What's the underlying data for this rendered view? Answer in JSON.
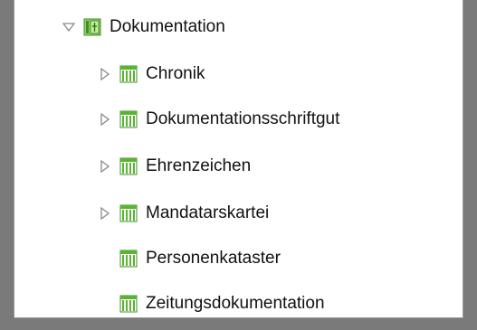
{
  "tree": {
    "root": {
      "label": "Dokumentation",
      "expanded": true,
      "icon": "folder-book-icon"
    },
    "children": [
      {
        "label": "Chronik",
        "has_children": true,
        "icon": "table-grid-icon"
      },
      {
        "label": "Dokumentationsschriftgut",
        "has_children": true,
        "icon": "table-grid-icon"
      },
      {
        "label": "Ehrenzeichen",
        "has_children": true,
        "icon": "table-grid-icon"
      },
      {
        "label": "Mandatarskartei",
        "has_children": true,
        "icon": "table-grid-icon"
      },
      {
        "label": "Personenkataster",
        "has_children": false,
        "icon": "table-grid-icon"
      },
      {
        "label": "Zeitungsdokumentation",
        "has_children": false,
        "icon": "table-grid-icon"
      }
    ]
  },
  "colors": {
    "icon_green": "#58b52f",
    "icon_dark": "#2e6e1b",
    "expander": "#8a8a8a",
    "text": "#111111"
  }
}
